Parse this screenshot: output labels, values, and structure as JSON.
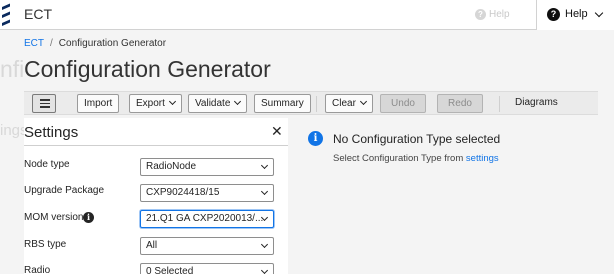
{
  "app": {
    "title": "ECT"
  },
  "ghost_help": {
    "label": "Help"
  },
  "help_menu": {
    "label": "Help"
  },
  "breadcrumb": {
    "root": "ECT",
    "separator": "/",
    "current": "Configuration Generator"
  },
  "page_title": "Configuration Generator",
  "toolbar": {
    "import": "Import",
    "export": "Export",
    "validate": "Validate",
    "summary": "Summary",
    "clear": "Clear",
    "undo": "Undo",
    "redo": "Redo",
    "diagrams": "Diagrams"
  },
  "settings": {
    "title": "Settings",
    "fields": [
      {
        "label": "Node type",
        "value": "RadioNode"
      },
      {
        "label": "Upgrade Package",
        "value": "CXP9024418/15"
      },
      {
        "label": "MOM version",
        "value": "21.Q1 GA CXP2020013/..."
      },
      {
        "label": "RBS type",
        "value": "All"
      },
      {
        "label": "Radio",
        "value": "0 Selected"
      }
    ]
  },
  "info": {
    "title": "No Configuration Type selected",
    "subtitle_prefix": "Select Configuration Type from ",
    "subtitle_link": "settings"
  },
  "colors": {
    "accent": "#1174e6",
    "toolbar_bg": "#ebebeb",
    "page_bg": "#f4f4f4"
  },
  "icons": {
    "logo": "ericsson-logo-icon",
    "help": "question-circle-icon",
    "list": "list-icon",
    "close": "close-icon",
    "info": "info-icon",
    "chevron": "chevron-down-icon"
  }
}
